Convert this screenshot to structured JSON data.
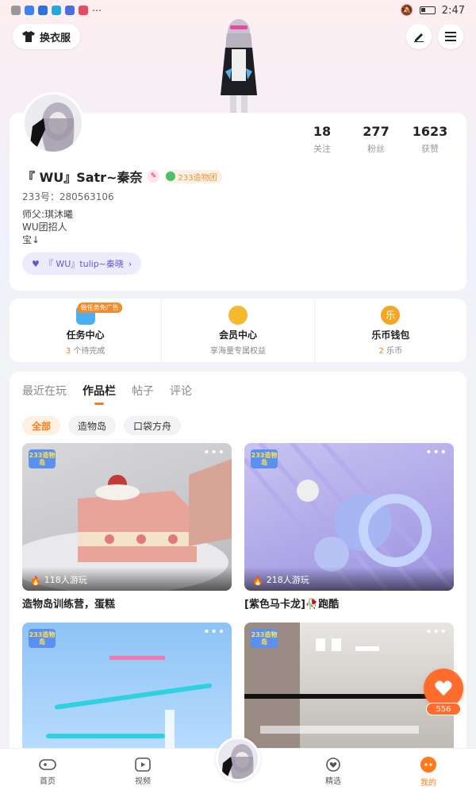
{
  "status_bar": {
    "time": "2:47"
  },
  "header": {
    "outfit_label": "换衣服"
  },
  "profile": {
    "name": "『 WU』Satr~秦奈",
    "team_badge": "233造物团",
    "uid": "233号：280563106",
    "bio": [
      "师父:琪沐曦",
      "WU团招人",
      "宝↓"
    ],
    "relation": "『 WU』tulip~秦晓",
    "stats": [
      {
        "value": "18",
        "label": "关注"
      },
      {
        "value": "277",
        "label": "粉丝"
      },
      {
        "value": "1623",
        "label": "获赞"
      }
    ]
  },
  "quick": [
    {
      "title": "任务中心",
      "highlight": "3",
      "rest": "个待完成",
      "tag": "做任务免广告"
    },
    {
      "title": "会员中心",
      "highlight": "",
      "rest": "享海量专属权益",
      "tag": ""
    },
    {
      "title": "乐币钱包",
      "highlight": "2",
      "rest": "乐币",
      "tag": ""
    }
  ],
  "tabs": [
    "最近在玩",
    "作品栏",
    "帖子",
    "评论"
  ],
  "chips": [
    "全部",
    "造物岛",
    "口袋方舟"
  ],
  "cards": [
    {
      "plays": "118人游玩",
      "title": "造物岛训练营，蛋糕",
      "logo": "233造物岛"
    },
    {
      "plays": "218人游玩",
      "title": "[紫色马卡龙]🥀跑酷",
      "logo": "233造物岛"
    },
    {
      "plays": "",
      "title": "",
      "logo": "233造物岛"
    },
    {
      "plays": "",
      "title": "",
      "logo": "233造物岛"
    }
  ],
  "like_count": "556",
  "nav": [
    "首页",
    "视频",
    "精选",
    "我的"
  ],
  "colors": {
    "accent": "#ff7a1a",
    "relation": "#6458c9",
    "like": "#ff6d2e"
  }
}
